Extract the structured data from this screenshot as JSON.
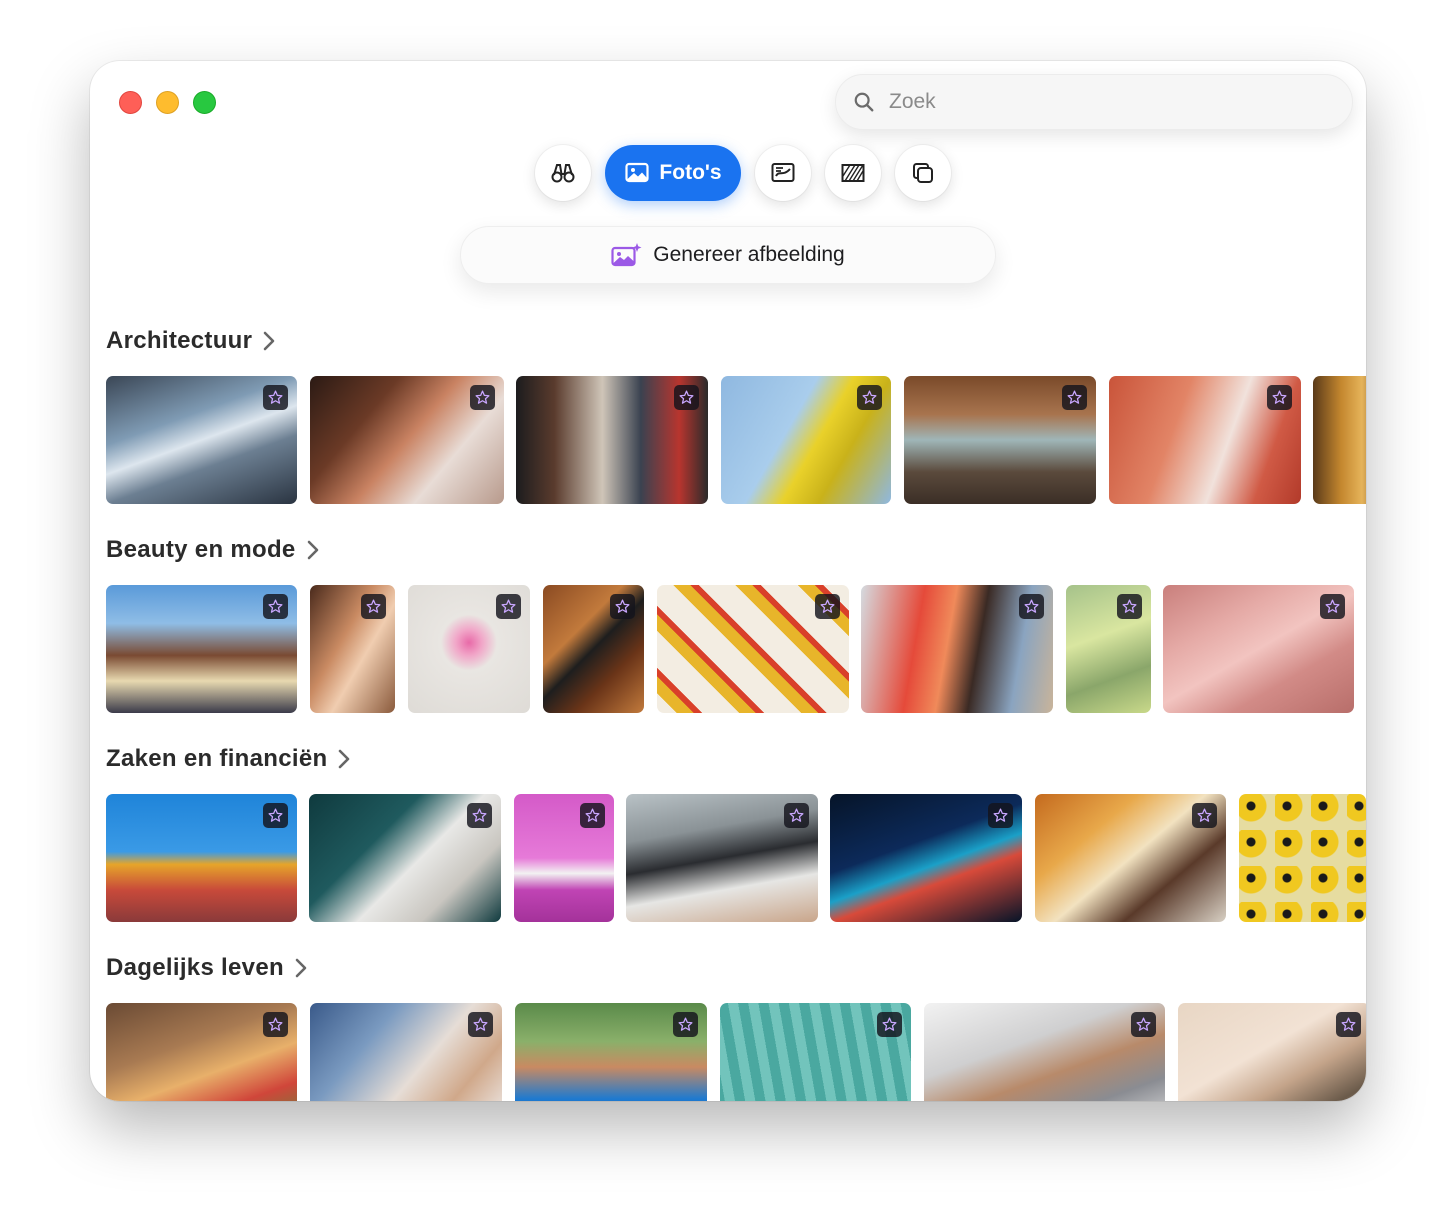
{
  "search": {
    "placeholder": "Zoek",
    "icon": "search-icon"
  },
  "tabs": [
    {
      "name": "discover",
      "icon": "binoculars-icon",
      "label": ""
    },
    {
      "name": "photos",
      "icon": "photo-icon",
      "label": "Foto's",
      "active": true
    },
    {
      "name": "illustrations",
      "icon": "illustration-icon",
      "label": ""
    },
    {
      "name": "templates",
      "icon": "pattern-icon",
      "label": ""
    },
    {
      "name": "collections",
      "icon": "stack-icon",
      "label": ""
    }
  ],
  "generate": {
    "label": "Genereer afbeelding",
    "icon": "ai-image-icon",
    "accent": "#9b59e6"
  },
  "accent_color": "#1a73f0",
  "sections": [
    {
      "title": "Architectuur",
      "thumbnails": 7
    },
    {
      "title": "Beauty en mode",
      "thumbnails": 8
    },
    {
      "title": "Zaken en financiën",
      "thumbnails": 7
    },
    {
      "title": "Dagelijks leven",
      "thumbnails": 6
    }
  ],
  "badge_icon": "premium-star-icon"
}
